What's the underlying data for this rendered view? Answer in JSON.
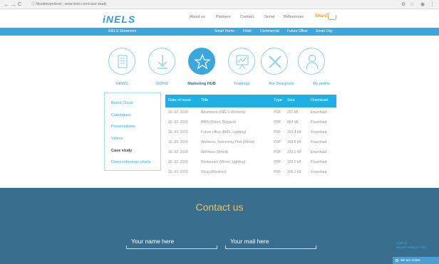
{
  "browser": {
    "back": "←",
    "forward": "→",
    "reload": "C",
    "url_secure": "Nezabezpečeno",
    "url": "www.inels.com/case-study"
  },
  "header": {
    "logo": "iNELS",
    "nav": [
      "About us",
      "Partners",
      "Contact",
      "Serial",
      "References"
    ],
    "share_label": "Share"
  },
  "subnav": {
    "brand": "iNELS Showroom",
    "items": [
      "Smart Home",
      "Hotel",
      "Commercial",
      "Future Office",
      "Smart City"
    ]
  },
  "categories": [
    {
      "label": "NEWS",
      "icon": "news-icon"
    },
    {
      "label": "SN/FW",
      "icon": "download-icon"
    },
    {
      "label": "Marketing HUB",
      "icon": "star-icon",
      "active": true
    },
    {
      "label": "Trainings",
      "icon": "chart-board-icon"
    },
    {
      "label": "For Designers",
      "icon": "pencil-ruler-icon"
    },
    {
      "label": "My profile",
      "icon": "user-icon"
    }
  ],
  "sidebar": {
    "items": [
      "Brand Cloud",
      "Catalogues",
      "Presentations",
      "Videos",
      "Case study",
      "Cross reference charts"
    ],
    "current_index": 4
  },
  "table": {
    "headers": [
      "Date of issue",
      "Title",
      "Type",
      "Size",
      "Download"
    ],
    "rows": [
      [
        "15. 03. 2018",
        "Apartment (iNELS Wireless)",
        "PDF",
        "257 kB",
        "Download"
      ],
      [
        "15. 03. 2018",
        "BMS (Wired, Niagara)",
        "PDF",
        "654 kB",
        "Download"
      ],
      [
        "15. 03. 2018",
        "Future office (BMS, Lighting)",
        "PDF",
        "263.4 kB",
        "Download"
      ],
      [
        "15. 03. 2018",
        "Wellness, Swimming Pool (Wired)",
        "PDF",
        "268.8 kB",
        "Download"
      ],
      [
        "15. 03. 2018",
        "Wellness (Wired)",
        "PDF",
        "339.6 kB",
        "Download"
      ],
      [
        "15. 03. 2018",
        "Restaurant (Wired, Lighting)",
        "PDF",
        "339.6 kB",
        "Download"
      ],
      [
        "15. 03. 2018",
        "Shop (Wireless)",
        "PDF",
        "206.2 kB",
        "Download"
      ]
    ]
  },
  "contact": {
    "title": "Contact us",
    "name_placeholder": "Your name here",
    "mail_placeholder": "Your mail here"
  },
  "chat": {
    "line1": "Hold on",
    "line2": "We are ready to help",
    "status": "We are online"
  },
  "colors": {
    "accent": "#3aa8dc",
    "table_header": "#22aee4",
    "footer": "#3a6e8e",
    "contact_title": "#f0c550",
    "share": "#f2a100"
  }
}
